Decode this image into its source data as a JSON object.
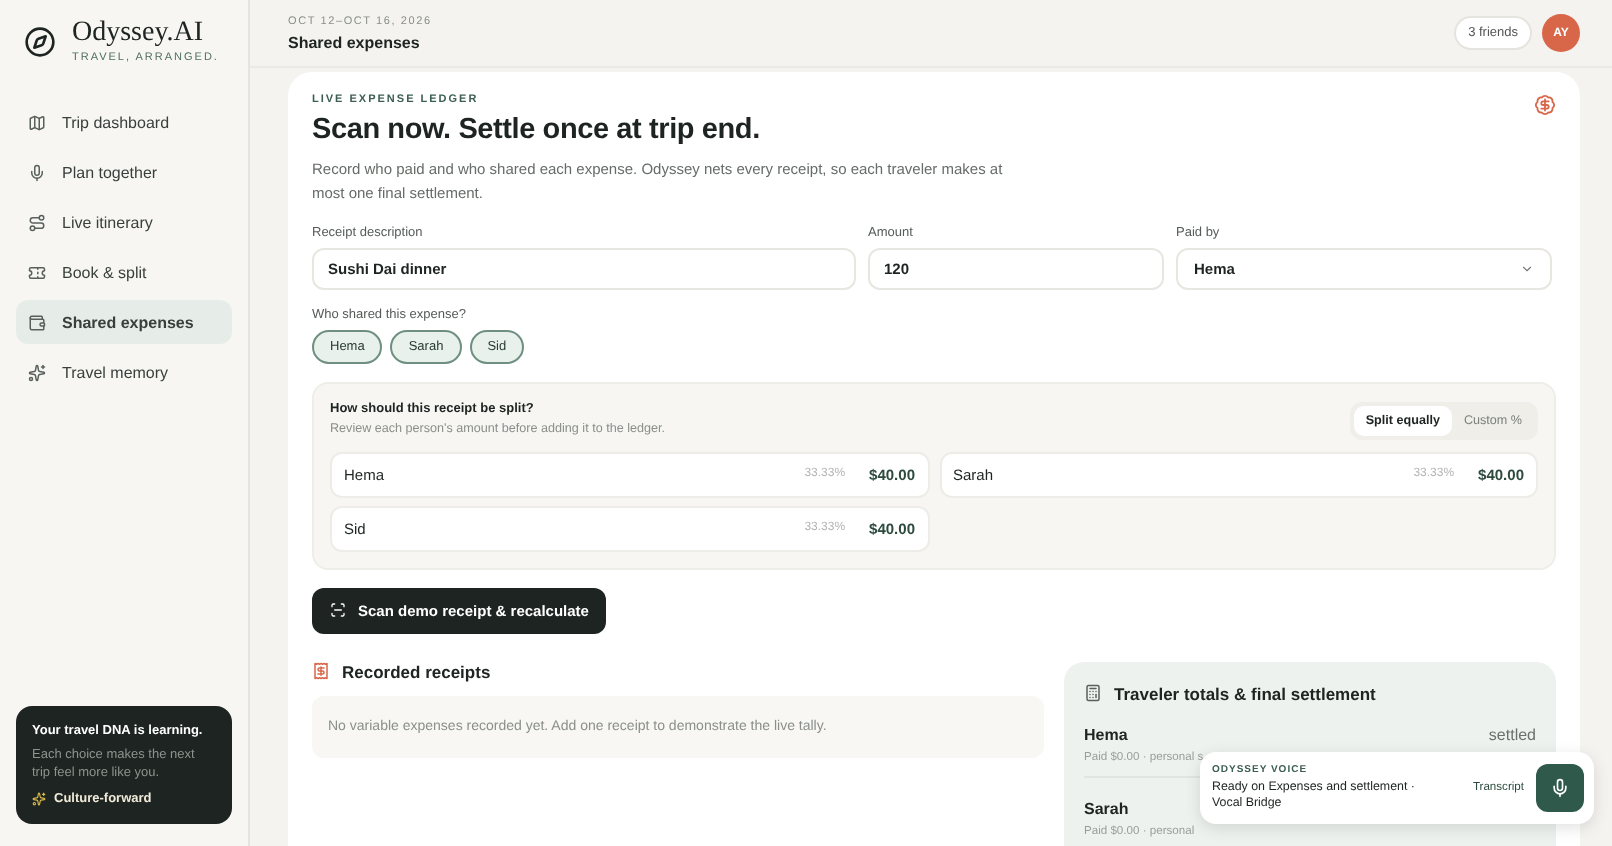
{
  "brand": {
    "name": "Odyssey.AI",
    "tagline": "TRAVEL, ARRANGED."
  },
  "nav": [
    {
      "label": "Trip dashboard",
      "selected": false
    },
    {
      "label": "Plan together",
      "selected": false
    },
    {
      "label": "Live itinerary",
      "selected": false
    },
    {
      "label": "Book & split",
      "selected": false
    },
    {
      "label": "Shared expenses",
      "selected": true
    },
    {
      "label": "Travel memory",
      "selected": false
    }
  ],
  "dna_card": {
    "title": "Your travel DNA is learning.",
    "text": "Each choice makes the next trip feel more like you.",
    "tag": "Culture-forward"
  },
  "header": {
    "dates": "OCT 12–OCT 16, 2026",
    "title": "Shared expenses",
    "friends": "3 friends",
    "avatar": "AY"
  },
  "ledger": {
    "eyebrow": "LIVE EXPENSE LEDGER",
    "title": "Scan now. Settle once at trip end.",
    "description": "Record who paid and who shared each expense. Odyssey nets every receipt, so each traveler makes at most one final settlement.",
    "fields": [
      {
        "kind": "text",
        "label": "Receipt description",
        "value": "Sushi Dai dinner"
      },
      {
        "kind": "text",
        "label": "Amount",
        "value": "120"
      },
      {
        "kind": "select",
        "label": "Paid by",
        "value": "Hema"
      }
    ],
    "shared_label": "Who shared this expense?",
    "sharers": [
      {
        "name": "Hema",
        "selected": true
      },
      {
        "name": "Sarah",
        "selected": true
      },
      {
        "name": "Sid",
        "selected": true
      }
    ],
    "split": {
      "question": "How should this receipt be split?",
      "hint": "Review each person's amount before adding it to the ledger.",
      "modes": [
        {
          "label": "Split equally",
          "selected": true
        },
        {
          "label": "Custom %",
          "selected": false
        }
      ],
      "rows": [
        {
          "name": "Hema",
          "percent": "33.33%",
          "amount": "$40.00"
        },
        {
          "name": "Sarah",
          "percent": "33.33%",
          "amount": "$40.00"
        },
        {
          "name": "Sid",
          "percent": "33.33%",
          "amount": "$40.00"
        }
      ]
    },
    "scan_button": "Scan demo receipt & recalculate"
  },
  "receipts": {
    "title": "Recorded receipts",
    "empty": "No variable expenses recorded yet. Add one receipt to demonstrate the live tally."
  },
  "totals": {
    "title": "Traveler totals & final settlement",
    "rows": [
      {
        "name": "Hema",
        "status": "settled",
        "detail": "Paid $0.00 · personal s"
      },
      {
        "name": "Sarah",
        "detail": "Paid $0.00 · personal"
      }
    ]
  },
  "voice": {
    "eyebrow": "ODYSSEY VOICE",
    "message": "Ready on Expenses and settlement · Vocal Bridge",
    "link": "Transcript"
  }
}
